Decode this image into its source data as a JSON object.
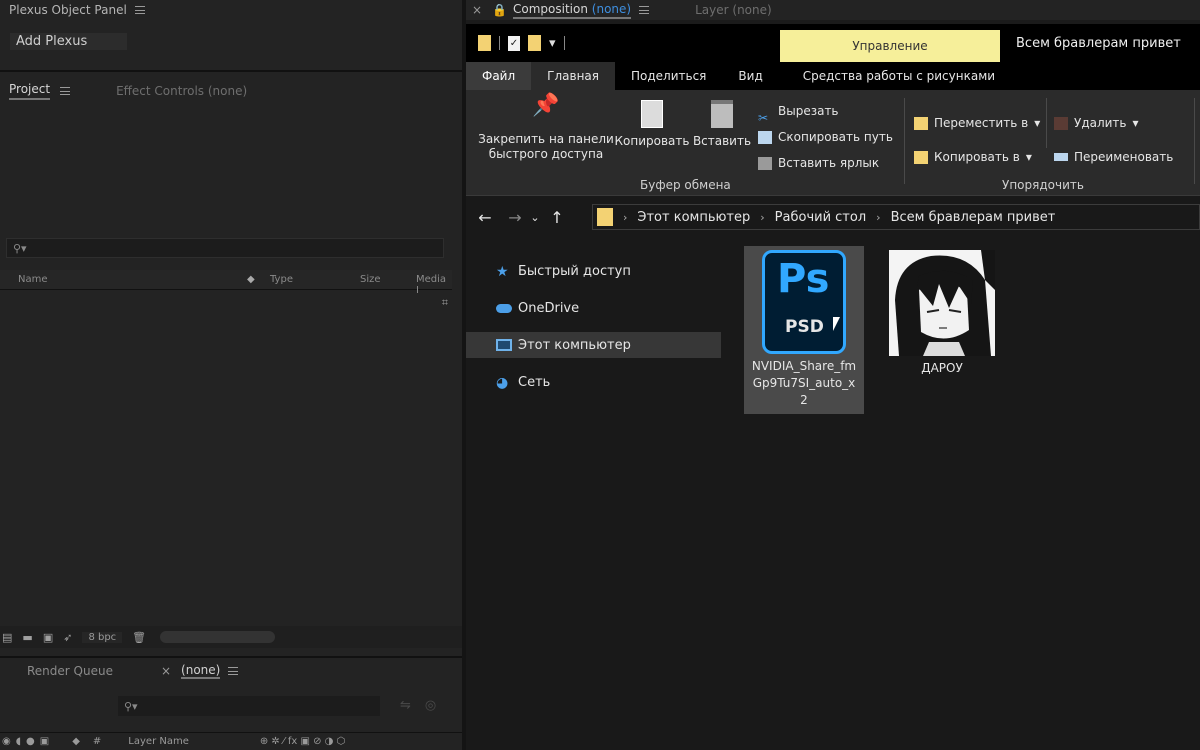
{
  "ae": {
    "plexus_title": "Plexus Object Panel",
    "add_plexus": "Add Plexus",
    "project_tab": "Project",
    "effect_controls_tab": "Effect Controls (none)",
    "columns": {
      "name": "Name",
      "type": "Type",
      "size": "Size",
      "media": "Media I"
    },
    "bpc": "8 bpc",
    "render_queue_tab": "Render Queue",
    "timeline_tab": "(none)",
    "layer_name_col": "Layer Name",
    "composition_tab_prefix": "Composition",
    "composition_tab_value": "(none)",
    "layer_tab": "Layer (none)"
  },
  "explorer": {
    "manage_tab": "Управление",
    "window_title": "Всем бравлерам привет",
    "ribbon_tabs": [
      "Файл",
      "Главная",
      "Поделиться",
      "Вид",
      "Средства работы с рисунками"
    ],
    "clipboard": {
      "pin_label_1": "Закрепить на панели",
      "pin_label_2": "быстрого доступа",
      "copy": "Копировать",
      "paste": "Вставить",
      "cut": "Вырезать",
      "copy_path": "Скопировать путь",
      "paste_shortcut": "Вставить ярлык",
      "group": "Буфер обмена"
    },
    "organize": {
      "move_to": "Переместить в",
      "copy_to": "Копировать в",
      "delete": "Удалить",
      "rename": "Переименовать",
      "group": "Упорядочить"
    },
    "breadcrumb": [
      "Этот компьютер",
      "Рабочий стол",
      "Всем бравлерам привет"
    ],
    "sidebar": [
      "Быстрый доступ",
      "OneDrive",
      "Этот компьютер",
      "Сеть"
    ],
    "files": [
      {
        "name_line1": "NVIDIA_Share_fm",
        "name_line2": "Gp9Tu7SI_auto_x",
        "name_line3": "2",
        "icon_text": "Ps",
        "icon_sub": "PSD"
      },
      {
        "name": "ДАРОУ"
      }
    ]
  },
  "colors": {
    "ps_blue": "#31a8ff",
    "manage_bg": "#f6ef9a",
    "folder": "#f3d273"
  }
}
